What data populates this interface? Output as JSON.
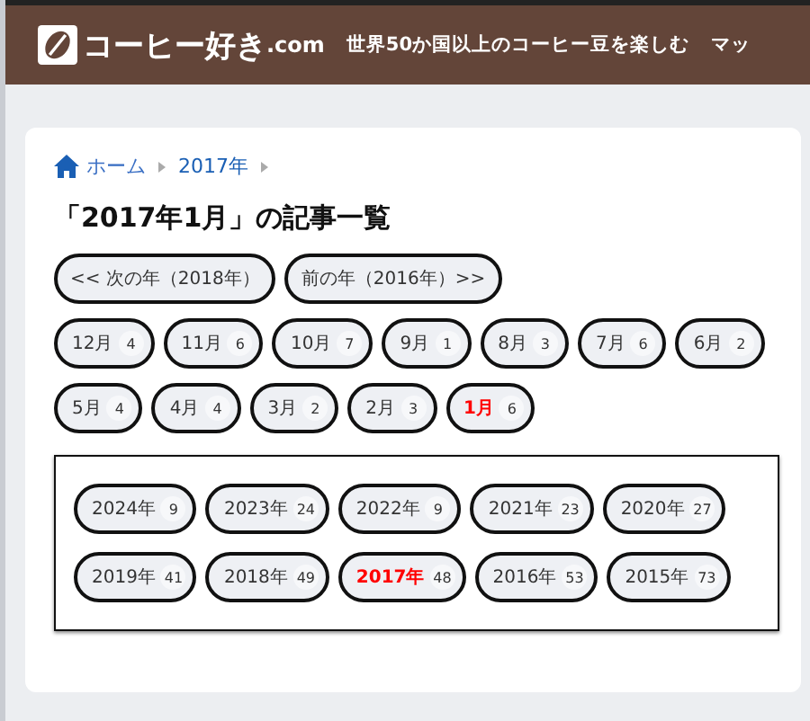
{
  "header": {
    "site_name": "コーヒー好き",
    "site_suffix": ".com",
    "tagline": "世界50か国以上のコーヒー豆を楽しむ",
    "nav_item": "マッ"
  },
  "breadcrumb": [
    {
      "label": "ホーム",
      "kind": "home"
    },
    {
      "label": "2017年",
      "kind": "link"
    }
  ],
  "title": "「2017年1月」の記事一覧",
  "year_nav": [
    "<< 次の年（2018年）",
    "前の年（2016年）>>"
  ],
  "months": [
    {
      "label": "12月",
      "count": "4",
      "selected": false
    },
    {
      "label": "11月",
      "count": "6",
      "selected": false
    },
    {
      "label": "10月",
      "count": "7",
      "selected": false
    },
    {
      "label": "9月",
      "count": "1",
      "selected": false
    },
    {
      "label": "8月",
      "count": "3",
      "selected": false
    },
    {
      "label": "7月",
      "count": "6",
      "selected": false
    },
    {
      "label": "6月",
      "count": "2",
      "selected": false
    },
    {
      "label": "5月",
      "count": "4",
      "selected": false
    },
    {
      "label": "4月",
      "count": "4",
      "selected": false
    },
    {
      "label": "3月",
      "count": "2",
      "selected": false
    },
    {
      "label": "2月",
      "count": "3",
      "selected": false
    },
    {
      "label": "1月",
      "count": "6",
      "selected": true
    }
  ],
  "years": [
    {
      "label": "2024年",
      "count": "9",
      "selected": false
    },
    {
      "label": "2023年",
      "count": "24",
      "selected": false
    },
    {
      "label": "2022年",
      "count": "9",
      "selected": false
    },
    {
      "label": "2021年",
      "count": "23",
      "selected": false
    },
    {
      "label": "2020年",
      "count": "27",
      "selected": false
    },
    {
      "label": "2019年",
      "count": "41",
      "selected": false
    },
    {
      "label": "2018年",
      "count": "49",
      "selected": false
    },
    {
      "label": "2017年",
      "count": "48",
      "selected": true
    },
    {
      "label": "2016年",
      "count": "53",
      "selected": false
    },
    {
      "label": "2015年",
      "count": "73",
      "selected": false
    }
  ]
}
